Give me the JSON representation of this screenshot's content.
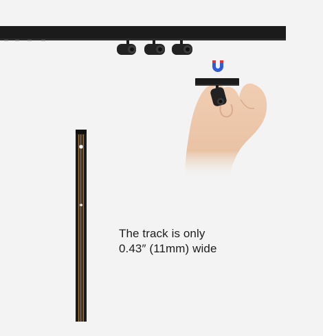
{
  "caption": {
    "line1": "The track is only",
    "line2": "0.43″ (11mm) wide"
  },
  "icons": {
    "magnet": "magnet-icon"
  },
  "colors": {
    "background": "#f3f3f3",
    "track": "#1b1b1b",
    "copper_strip": "#b07a3c",
    "magnet_red": "#e0323a",
    "magnet_blue": "#2f5bd8",
    "skin": "#ecc7aa"
  }
}
